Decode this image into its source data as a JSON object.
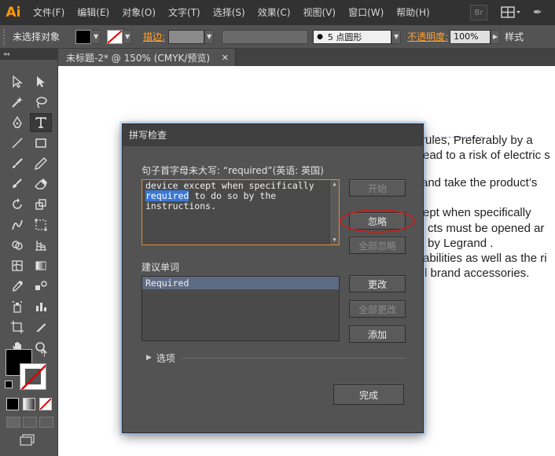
{
  "app": {
    "logo": "Ai",
    "menu": [
      "文件(F)",
      "编辑(E)",
      "对象(O)",
      "文字(T)",
      "选择(S)",
      "效果(C)",
      "视图(V)",
      "窗口(W)",
      "帮助(H)"
    ],
    "bridge_label": "Br"
  },
  "controlbar": {
    "selection_label": "未选择对象",
    "stroke_label": "描边:",
    "brush_label": "5 点圆形",
    "opacity_label": "不透明度:",
    "opacity_value": "100%",
    "style_label": "样式"
  },
  "tab": {
    "title": "未标题-2* @ 150% (CMYK/预览)",
    "close": "✕"
  },
  "document": {
    "lines": [
      "rules,  Preferably by a",
      "ead to a risk of electric s",
      "and take the product’s",
      "ept when specifically",
      "cts must be opened ar",
      "by Legrand .",
      "abilities as well as the ri",
      "l brand accessories."
    ]
  },
  "dialog": {
    "title": "拼写检查",
    "issue_label": "句子首字母未大写: “required”(英语: 英国)",
    "text_line1": "device except when specifically",
    "text_highlight": "required",
    "text_line2_rest": " to do so by the",
    "text_line3": "instructions.",
    "suggestions_label": "建议单词",
    "suggestions": [
      "Required"
    ],
    "options_label": "选项",
    "buttons": {
      "start": "开始",
      "ignore": "忽略",
      "ignore_all": "全部忽略",
      "change": "更改",
      "change_all": "全部更改",
      "add": "添加",
      "done": "完成"
    }
  },
  "colors": {
    "accent_orange": "#ffa330",
    "highlight_blue": "#3a78d4",
    "annotation_red": "#c42020"
  }
}
